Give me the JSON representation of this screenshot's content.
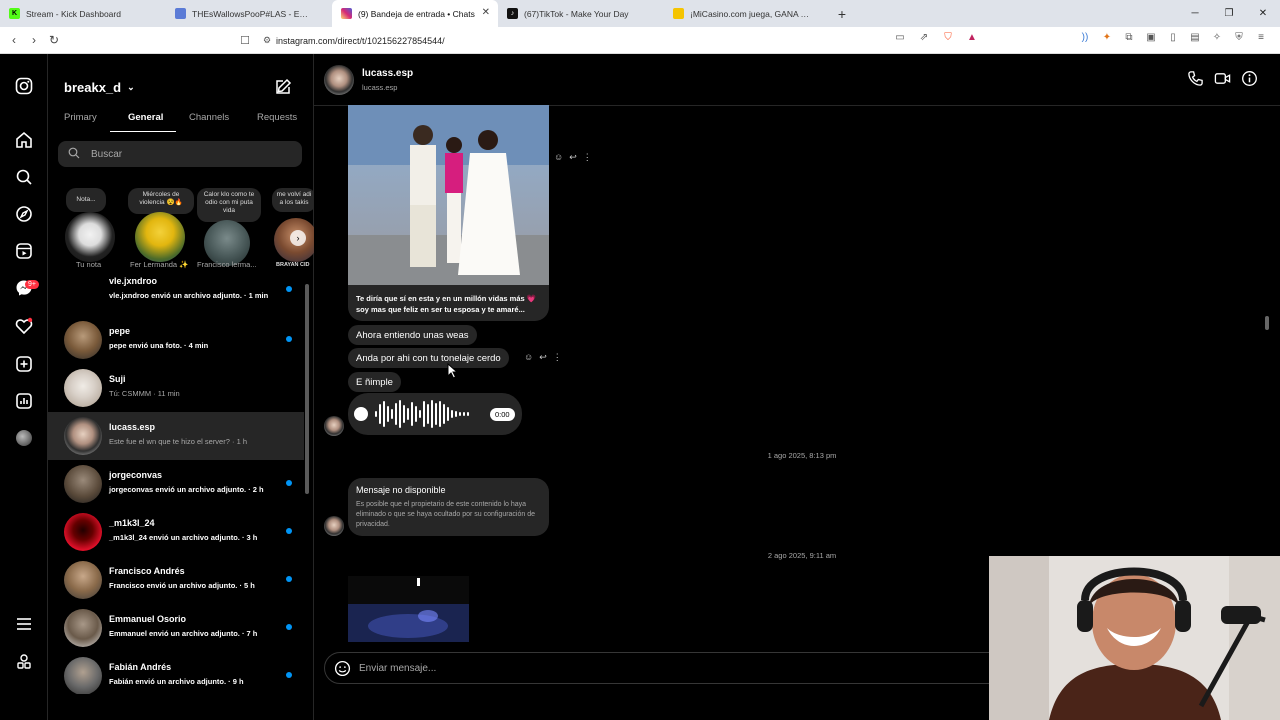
{
  "browser": {
    "tabs": [
      {
        "title": "Stream - Kick Dashboard",
        "favicon": "kick-icon",
        "color": "#53fc18",
        "glyph": "K"
      },
      {
        "title": "THEsWallowsPooP#LAS - Estadísticas",
        "favicon": "stats-icon",
        "color": "#5b7bd6",
        "glyph": ""
      },
      {
        "title": "(9) Bandeja de entrada • Chats",
        "favicon": "instagram-icon",
        "color": "#d62976",
        "glyph": ""
      },
      {
        "title": "(67)TikTok - Make Your Day",
        "favicon": "tiktok-icon",
        "color": "#111111",
        "glyph": ""
      },
      {
        "title": "¡MiCasino.com juega, GANA y sobre",
        "favicon": "casino-icon",
        "color": "#f5c400",
        "glyph": ""
      }
    ],
    "url": "instagram.com/direct/t/102156227854544/"
  },
  "sidebar": {
    "account": "breakx_d",
    "tabs": [
      "Primary",
      "General",
      "Channels",
      "Requests"
    ],
    "active_tab": "General",
    "search_placeholder": "Buscar",
    "notes": [
      {
        "bubble": "Nota...",
        "name": "Tu nota"
      },
      {
        "bubble": "Miércoles de violencia 😵🔥",
        "name": "Fer Lermanda ✨"
      },
      {
        "bubble": "Calor klo como te odio con mi puta vida",
        "name": "Francisco lerma..."
      },
      {
        "bubble": "me volví adi a los takis",
        "name": "BRAYAN CID"
      }
    ],
    "conversations": [
      {
        "name": "vle.jxndroo",
        "preview": "vle.jxndroo envió un archivo adjunto. · 1 min",
        "unread": true
      },
      {
        "name": "pepe",
        "preview": "pepe envió una foto. · 4 min",
        "unread": true
      },
      {
        "name": "Suji",
        "preview": "Tú: CSMMM · 11 min",
        "unread": false
      },
      {
        "name": "lucass.esp",
        "preview": "Este fue el wn que te hizo el server? · 1 h",
        "unread": false
      },
      {
        "name": "jorgeconvas",
        "preview": "jorgeconvas envió un archivo adjunto. · 2 h",
        "unread": true
      },
      {
        "name": "_m1k3l_24",
        "preview": "_m1k3l_24 envió un archivo adjunto. · 3 h",
        "unread": true
      },
      {
        "name": "Francisco Andrés",
        "preview": "Francisco envió un archivo adjunto. · 5 h",
        "unread": true
      },
      {
        "name": "Emmanuel Osorio",
        "preview": "Emmanuel envió un archivo adjunto. · 7 h",
        "unread": true
      },
      {
        "name": "Fabián Andrés",
        "preview": "Fabián envió un archivo adjunto. · 9 h",
        "unread": true
      }
    ],
    "badge": "9+"
  },
  "chat": {
    "name": "lucass.esp",
    "username": "lucass.esp",
    "photo_caption": "Te diría que sí en esta y en un millón vidas más 💗 soy mas que feliz en ser tu esposa y te amaré...",
    "messages": [
      "Ahora entiendo unas weas",
      "Anda por ahi con tu tonelaje cerdo",
      "E ñimple"
    ],
    "voice_time": "0:00",
    "date1": "1 ago 2025, 8:13 pm",
    "unavailable_title": "Mensaje no disponible",
    "unavailable_desc": "Es posible que el propietario de este contenido lo haya eliminado o que se haya ocultado por su configuración de privacidad.",
    "date2": "2 ago 2025, 9:11 am",
    "composer_placeholder": "Enviar mensaje..."
  }
}
